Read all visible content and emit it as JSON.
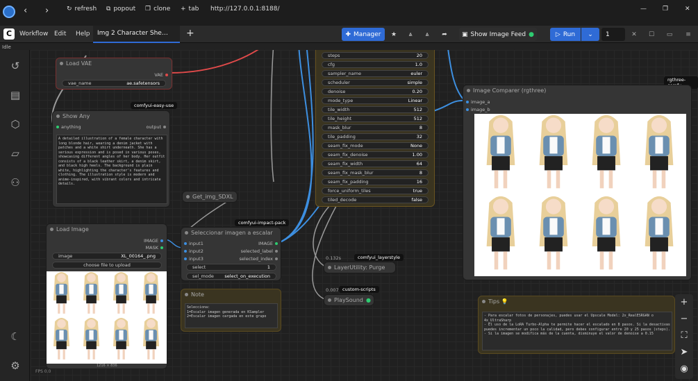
{
  "browser": {
    "refresh": "refresh",
    "popout": "popout",
    "clone": "clone",
    "tab": "tab",
    "url": "http://127.0.0.1:8188/"
  },
  "menu": {
    "workflow": "Workflow",
    "edit": "Edit",
    "help": "Help",
    "tab_title": "Img 2 Character She…",
    "add_tab": "+"
  },
  "toolbar": {
    "manager": "Manager",
    "feed": "Show Image Feed",
    "run": "Run",
    "batch": "1"
  },
  "status": {
    "idle": "Idle",
    "fps": "FPS 0.0"
  },
  "nodes": {
    "load_vae": {
      "title": "Load VAE",
      "out": "VAE",
      "w_label": "vae_name",
      "w_value": "ae.safetensors"
    },
    "show_any": {
      "title": "Show Any",
      "in": "anything",
      "out": "output",
      "badge": "comfyui-easy-use",
      "text": "A detailed illustration of a female character with long blonde hair, wearing a denim jacket with patches and a white shirt underneath. She has a serious expression and is posed in various poses, showcasing different angles of her body. Her outfit consists of a black leather skirt, a denim skirt, and black high heels. The background is plain white, highlighting the character's features and clothing. The illustration style is modern and anime-inspired, with vibrant colors and intricate details."
    },
    "get_img": {
      "title": "Get_img_SDXL"
    },
    "load_image": {
      "title": "Load Image",
      "out1": "IMAGE",
      "out2": "MASK",
      "w_label": "image",
      "w_value": "XL_00164_.png",
      "upload": "choose file to upload",
      "size": "1216 × 836"
    },
    "selector": {
      "title": "Seleccionar imagen a escalar",
      "badge": "comfyui-impact-pack",
      "in1": "input1",
      "in2": "input2",
      "in3": "input3",
      "out1": "IMAGE",
      "out2": "selected_label",
      "out3": "selected_index",
      "w1_label": "select",
      "w1_value": "1",
      "w2_label": "sel_mode",
      "w2_value": "select_on_execution"
    },
    "note": {
      "title": "Note",
      "text": "Selecciona:\n1=Escalar imagen generada en KSampler\n2=Escalar imagen cargada en este grupo"
    },
    "purge": {
      "title": "LayerUtility: Purge",
      "time": "0.132s",
      "badge": "comfyui_layerstyle"
    },
    "sound": {
      "title": "PlaySound",
      "time": "0.007s",
      "badge": "custom-scripts"
    },
    "comparer": {
      "title": "Image Comparer (rgthree)",
      "badge": "rgthree-comfy",
      "in1": "image_a",
      "in2": "image_b"
    },
    "tips": {
      "title": "Tips 💡",
      "text": "- Para escalar fotos de personajes, puedes usar el Upscale Model: 2x_RealESRGAN o 4x_UltraSharp\n- El uso de la LoRA Turbo-Alpha te permite hacer el escalado en 8 pasos. Si la desactivas puedes incrementar un poco la calidad, pero debes configurar entre 20 y 25 pasos (steps).\n- Si la imagen se modifica más de la cuenta, disminuye el valor de denoise a 0.15"
    }
  },
  "upscaler": [
    {
      "label": "steps",
      "value": "20"
    },
    {
      "label": "cfg",
      "value": "1.0"
    },
    {
      "label": "sampler_name",
      "value": "euler"
    },
    {
      "label": "scheduler",
      "value": "simple"
    },
    {
      "label": "denoise",
      "value": "0.20"
    },
    {
      "label": "mode_type",
      "value": "Linear"
    },
    {
      "label": "tile_width",
      "value": "512"
    },
    {
      "label": "tile_height",
      "value": "512"
    },
    {
      "label": "mask_blur",
      "value": "8"
    },
    {
      "label": "tile_padding",
      "value": "32"
    },
    {
      "label": "seam_fix_mode",
      "value": "None"
    },
    {
      "label": "seam_fix_denoise",
      "value": "1.00"
    },
    {
      "label": "seam_fix_width",
      "value": "64"
    },
    {
      "label": "seam_fix_mask_blur",
      "value": "8"
    },
    {
      "label": "seam_fix_padding",
      "value": "16"
    },
    {
      "label": "force_uniform_tiles",
      "value": "true"
    },
    {
      "label": "tiled_decode",
      "value": "false"
    }
  ],
  "colors": {
    "accent": "#2f6bd6",
    "ok": "#2ecc71",
    "node_bg": "#353535",
    "link_blue": "#3d8fe0",
    "link_red": "#e04a4a",
    "link_gray": "#9a9a9a"
  }
}
